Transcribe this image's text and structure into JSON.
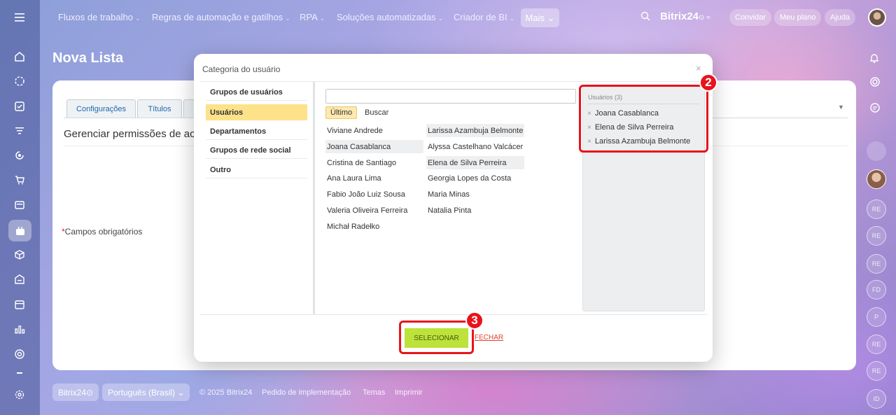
{
  "topnav": {
    "items": [
      {
        "label": "Fluxos de trabalho",
        "chev": "⌄"
      },
      {
        "label": "Regras de automação e gatilhos",
        "chev": "⌄"
      },
      {
        "label": "RPA",
        "chev": "⌄"
      },
      {
        "label": "Soluções automatizadas",
        "chev": "⌄"
      },
      {
        "label": "Criador de BI",
        "chev": "⌄"
      }
    ],
    "more_label": "Mais ⌄",
    "brand": "Bitrix24",
    "brand_suffix": "⊙ ≈",
    "invite_label": "Convidar",
    "plan_label": "Meu plano",
    "help_label": "Ajuda"
  },
  "page": {
    "title": "Nova Lista",
    "tabs": [
      "Configurações",
      "Títulos"
    ],
    "permissions_title": "Gerenciar permissões de ac",
    "required_star": "*",
    "required_label": "Campos obrigatórios"
  },
  "footer": {
    "brand": "Bitrix24⊙",
    "language": "Português (Brasil) ⌄",
    "copyright": "© 2025 Bitrix24",
    "links": [
      "Pedido de implementação",
      "Temas",
      "Imprimir"
    ]
  },
  "rail": {
    "avatars": [
      "RE",
      "RE",
      "RE",
      "FD",
      "P",
      "RE",
      "RE",
      "ID"
    ]
  },
  "dialog": {
    "title": "Categoria do usuário",
    "close_glyph": "×",
    "categories": [
      "Grupos de usuários",
      "Usuários",
      "Departamentos",
      "Grupos de rede social",
      "Outro"
    ],
    "active_category": "Usuários",
    "subtabs": [
      "Último",
      "Buscar"
    ],
    "users_col1": [
      "Viviane Andrede",
      "Joana Casablanca",
      "Cristina de Santiago",
      "Ana Laura Lima",
      "Fabio João Luiz Sousa",
      "Valeria Oliveira Ferreira",
      "Michał Radełko"
    ],
    "users_col2": [
      "Larissa Azambuja Belmonte",
      "Alyssa Castelhano Valcácer",
      "Elena de Silva Perreira",
      "Georgia Lopes da Costa",
      "Maria Minas",
      "Natalia Pinta"
    ],
    "selected_header": "Usuários (3)",
    "selected": [
      "Joana Casablanca",
      "Elena de Silva Perreira",
      "Larissa Azambuja Belmonte"
    ],
    "remove_glyph": "×",
    "select_label": "SELECIONAR",
    "close_label": "FECHAR"
  },
  "callouts": {
    "badge_2": "2",
    "badge_3": "3"
  },
  "colors": {
    "accent_green": "#bde23a",
    "highlight": "#fde28a",
    "callout_red": "#e8131b"
  },
  "icons": {
    "sidebar": [
      "menu-icon",
      "home-icon",
      "chat-icon",
      "tasks-icon",
      "filter-icon",
      "crm-icon",
      "cart-icon",
      "sites-icon",
      "automation-icon",
      "box-icon",
      "warehouse-icon",
      "calendar-icon",
      "analytics-icon",
      "target-icon",
      "settings-icon"
    ]
  }
}
